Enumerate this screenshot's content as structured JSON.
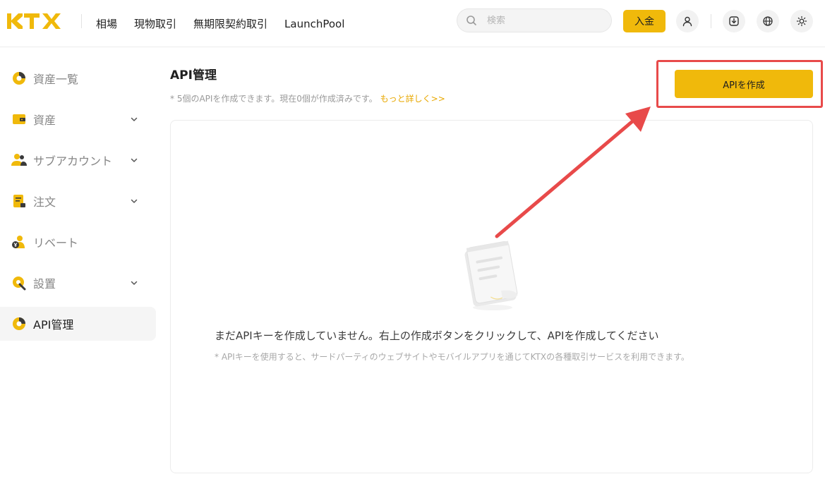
{
  "header": {
    "logo_text": "KTX",
    "nav": [
      "相場",
      "現物取引",
      "無期限契約取引",
      "LaunchPool"
    ],
    "search_placeholder": "検索",
    "deposit_label": "入金",
    "icons": [
      "user-icon",
      "download-icon",
      "globe-icon",
      "sun-icon"
    ]
  },
  "sidebar": {
    "items": [
      {
        "label": "資産一覧",
        "icon": "pie-chart-icon",
        "has_chevron": false
      },
      {
        "label": "資産",
        "icon": "wallet-icon",
        "has_chevron": true
      },
      {
        "label": "サブアカウント",
        "icon": "users-icon",
        "has_chevron": true
      },
      {
        "label": "注文",
        "icon": "document-icon",
        "has_chevron": true
      },
      {
        "label": "リベート",
        "icon": "rebate-icon",
        "has_chevron": false
      },
      {
        "label": "設置",
        "icon": "settings-icon",
        "has_chevron": true
      },
      {
        "label": "API管理",
        "icon": "api-icon",
        "has_chevron": false,
        "active": true
      }
    ]
  },
  "main": {
    "title": "API管理",
    "subtitle": "* 5個のAPIを作成できます。現在0個が作成済みです。",
    "more_link": "もっと詳しく>>",
    "create_button": "APIを作成",
    "empty_title": "まだAPIキーを作成していません。右上の作成ボタンをクリックして、APIを作成してください",
    "empty_desc": "* APIキーを使用すると、サードパーティのウェブサイトやモバイルアプリを通じてKTXの各種取引サービスを利用できます。"
  },
  "colors": {
    "accent": "#f0b90b",
    "link": "#e8a800",
    "highlight": "#e84a4a"
  }
}
